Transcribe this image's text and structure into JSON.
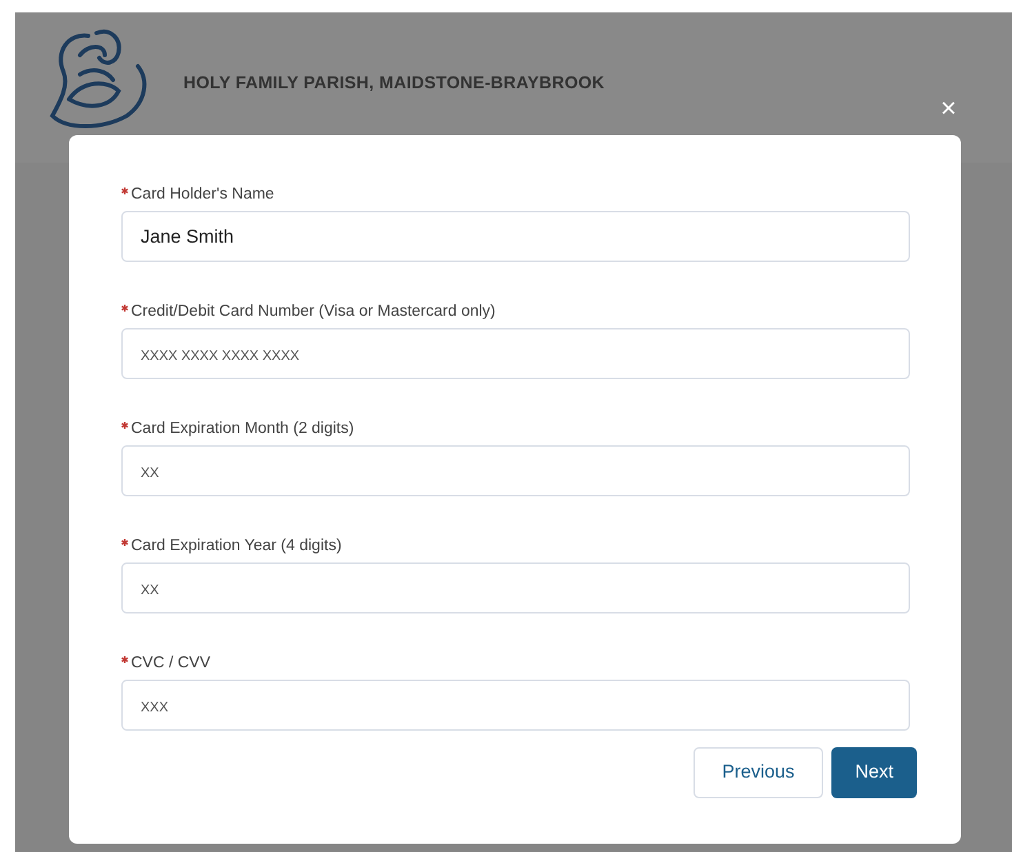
{
  "header": {
    "title": "HOLY FAMILY PARISH, MAIDSTONE-BRAYBROOK",
    "close": "×"
  },
  "fields": [
    {
      "label": "Card Holder's Name",
      "required": true,
      "value": "Jane Smith"
    },
    {
      "label": "Credit/Debit Card Number (Visa or Mastercard only)",
      "required": true,
      "placeholder": "XXXX XXXX XXXX XXXX"
    },
    {
      "label": "Card Expiration Month (2 digits)",
      "required": true,
      "placeholder": "XX"
    },
    {
      "label": "Card Expiration Year (4 digits)",
      "required": true,
      "placeholder": "XX"
    },
    {
      "label": "CVC / CVV",
      "required": true,
      "placeholder": "XXX"
    }
  ],
  "buttons": [
    {
      "label": "Previous",
      "kind": "secondary"
    },
    {
      "label": "Next",
      "kind": "primary"
    }
  ]
}
